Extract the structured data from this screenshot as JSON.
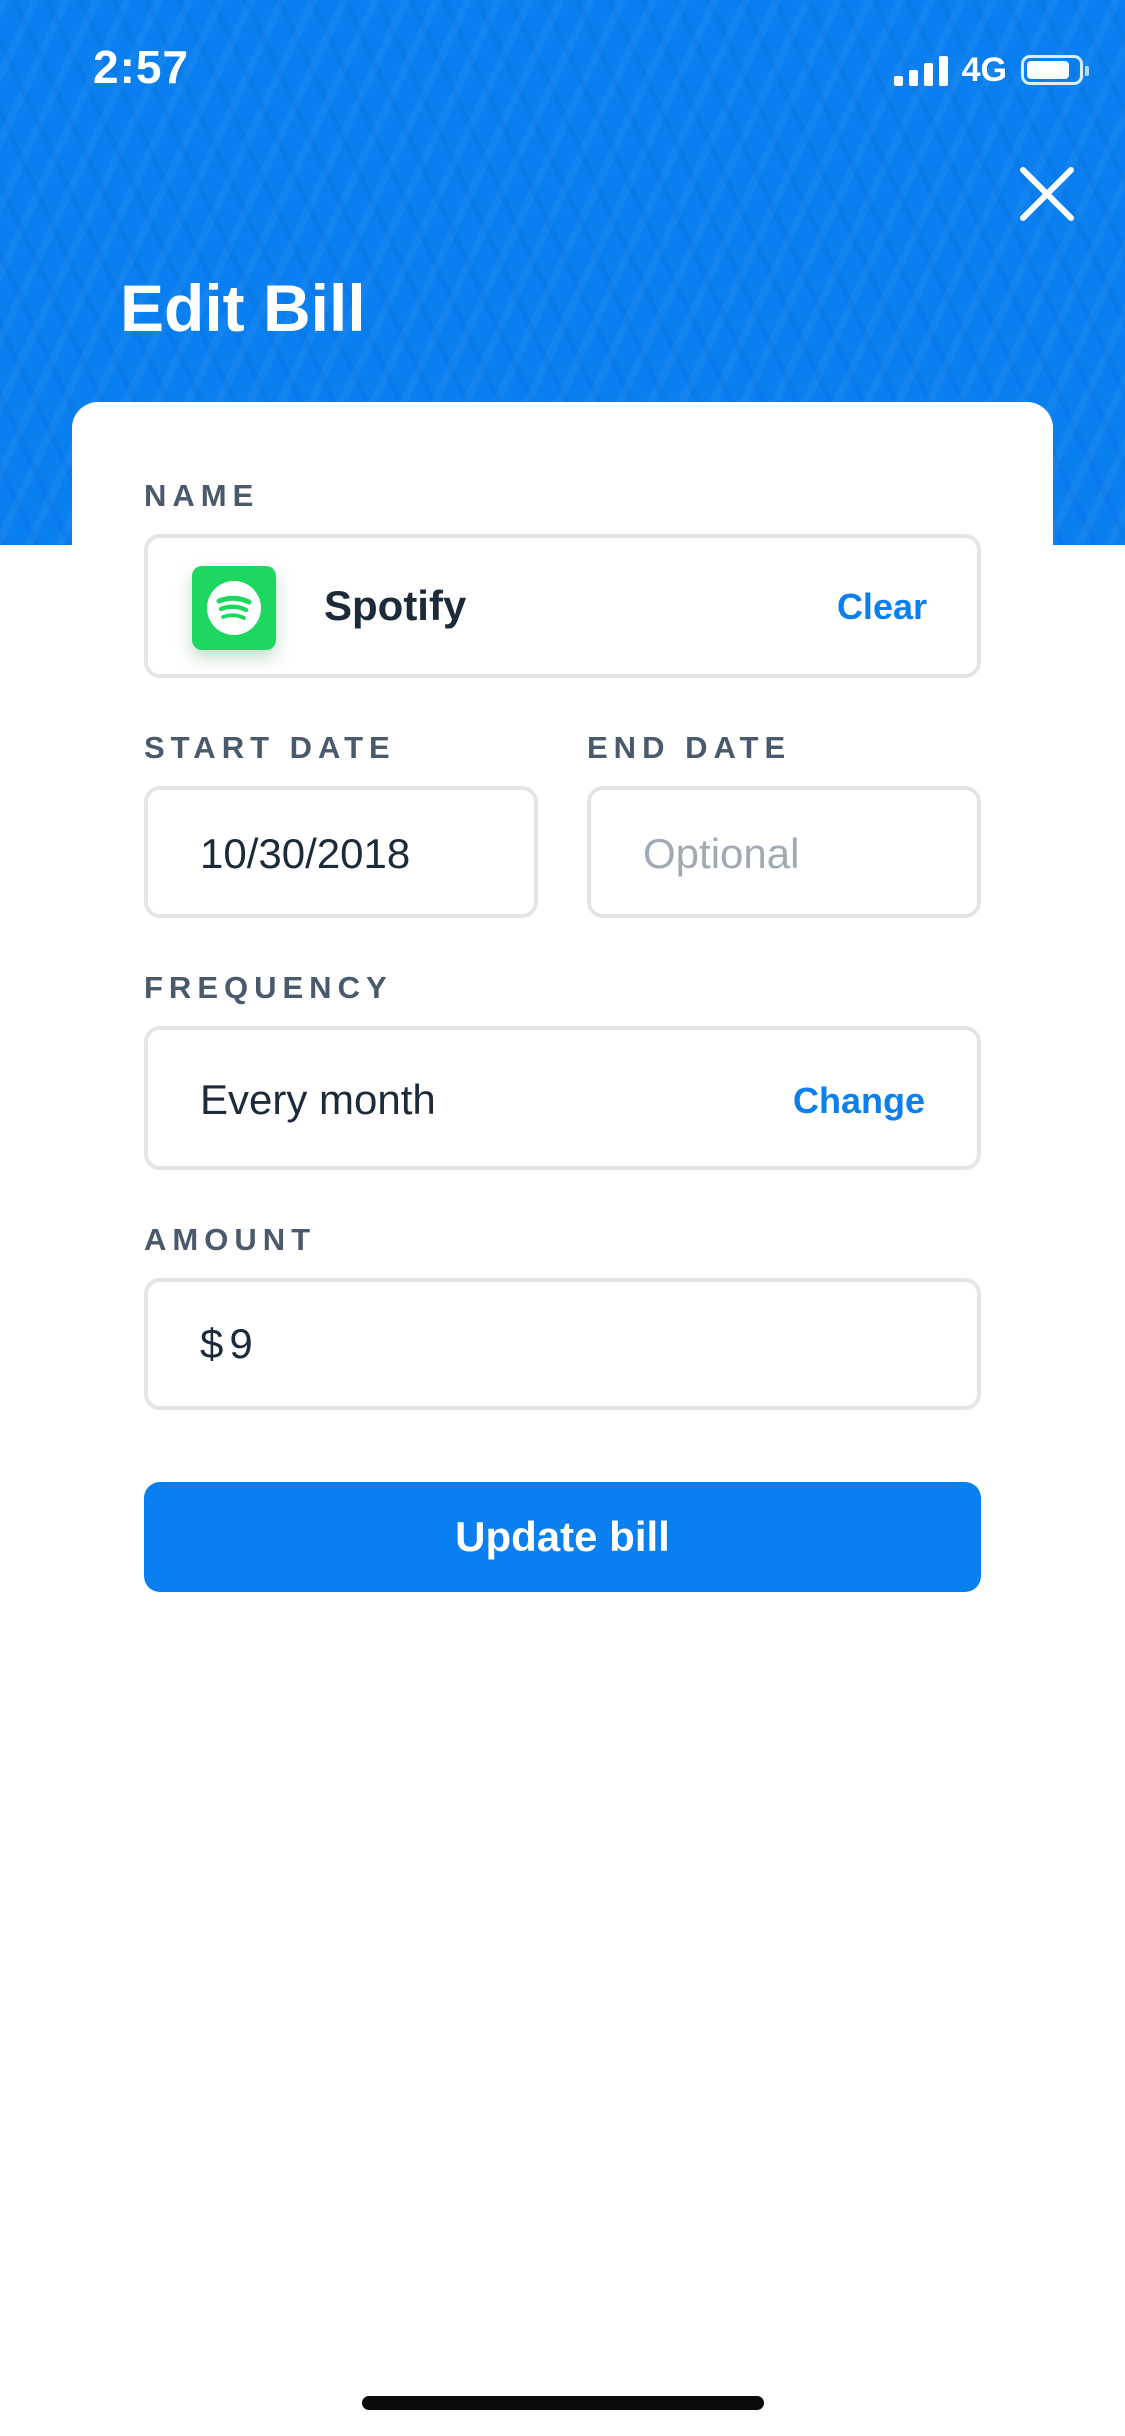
{
  "status_bar": {
    "time": "2:57",
    "network": "4G",
    "signal_icon": "signal-bars-icon",
    "battery_icon": "battery-icon"
  },
  "header": {
    "title": "Edit Bill",
    "close_icon": "close-icon",
    "color": "#0a7ff0"
  },
  "form": {
    "name": {
      "label": "NAME",
      "value": "Spotify",
      "icon": "spotify-icon",
      "action": "Clear"
    },
    "start_date": {
      "label": "START DATE",
      "value": "10/30/2018"
    },
    "end_date": {
      "label": "END DATE",
      "value": "",
      "placeholder": "Optional"
    },
    "frequency": {
      "label": "FREQUENCY",
      "value": "Every month",
      "action": "Change"
    },
    "amount": {
      "label": "AMOUNT",
      "currency": "$",
      "value": "9"
    }
  },
  "submit": {
    "label": "Update bill"
  },
  "colors": {
    "accent": "#0a7ff0",
    "spotify": "#1ed760",
    "label": "#4a5a6c",
    "text": "#1c2a3a",
    "placeholder": "#a1aab4",
    "border": "#e3e6e9"
  }
}
